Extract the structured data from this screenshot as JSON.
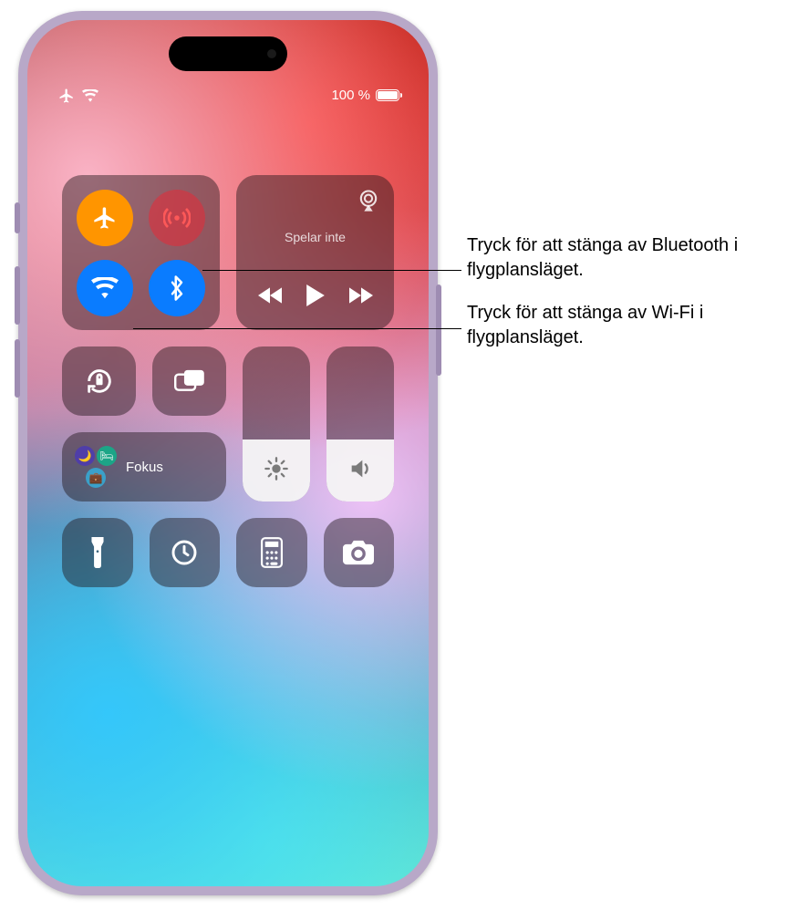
{
  "status": {
    "battery_text": "100 %"
  },
  "media": {
    "title": "Spelar inte"
  },
  "focus": {
    "label": "Fokus"
  },
  "sliders": {
    "brightness_pct": 40,
    "volume_pct": 40
  },
  "callouts": {
    "bluetooth": "Tryck för att stänga av Bluetooth i flygplansläget.",
    "wifi": "Tryck för att stänga av Wi‑Fi i flygplansläget."
  }
}
